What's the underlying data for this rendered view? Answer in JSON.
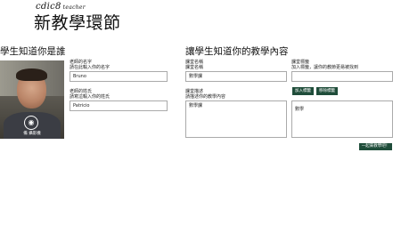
{
  "header": {
    "logo_text": "cdic8",
    "logo_sub": "teacher",
    "page_title": "新教學環節"
  },
  "left": {
    "section_title": "學生知道你是誰",
    "camera_label": "備 攝影機",
    "teacher_name_label": "老師的名字",
    "teacher_name_hint": "請在此輸入你的名字",
    "teacher_name_value": "Bruno",
    "teacher_surname_label": "老師的姓氏",
    "teacher_surname_hint": "請寫這輸入你的姓氏",
    "teacher_surname_value": "Patricio"
  },
  "right": {
    "section_title": "讓學生知道你的教學內容",
    "course_name_label": "課堂名稱",
    "course_name_hint": "課堂名稱",
    "course_name_value": "數學課",
    "course_tags_label": "課堂標籤",
    "course_tags_hint": "加入標籤，讓你的教節更易被找到",
    "course_tags_value": "",
    "add_tag_button": "加入標籤",
    "remove_tag_button": "移除標籤",
    "tag_list_value": "數學",
    "course_desc_label": "課堂描述",
    "course_desc_hint": "請描述你的教學內容",
    "course_desc_value": "數學課",
    "start_button": "一起來教學吧！"
  }
}
